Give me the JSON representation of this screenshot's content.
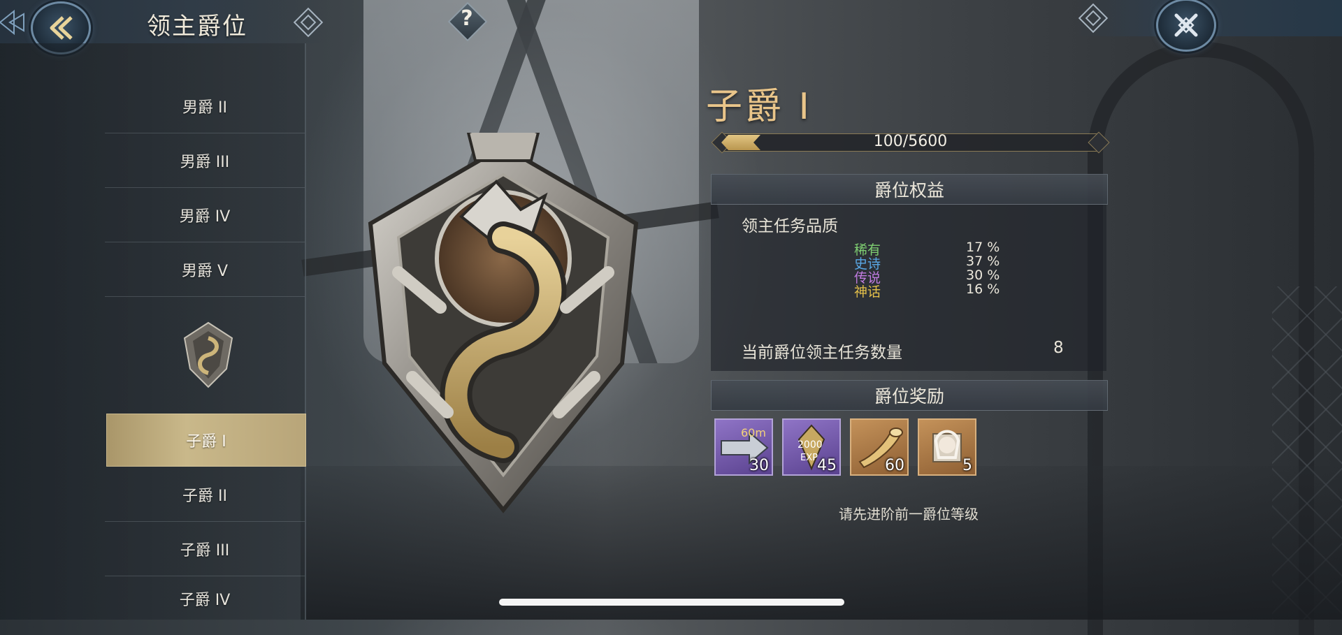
{
  "header": {
    "title": "领主爵位",
    "help_label": "?"
  },
  "sidebar": {
    "items": [
      {
        "label": "男爵 II",
        "active": false
      },
      {
        "label": "男爵 III",
        "active": false
      },
      {
        "label": "男爵 IV",
        "active": false
      },
      {
        "label": "男爵 V",
        "active": false
      },
      {
        "label": "子爵 I",
        "active": true
      },
      {
        "label": "子爵 II",
        "active": false
      },
      {
        "label": "子爵 III",
        "active": false
      },
      {
        "label": "子爵 IV",
        "active": false
      }
    ]
  },
  "detail": {
    "title": "子爵 I",
    "progress": {
      "text": "100/5600",
      "current": 100,
      "max": 5600
    },
    "benefits": {
      "header": "爵位权益",
      "quality_label": "领主任务品质",
      "qualities": [
        {
          "name": "稀有",
          "value": "17 %",
          "color": "#7fcf72"
        },
        {
          "name": "史诗",
          "value": "37 %",
          "color": "#5aa8e6"
        },
        {
          "name": "传说",
          "value": "30 %",
          "color": "#c07be0"
        },
        {
          "name": "神话",
          "value": "16 %",
          "color": "#e3bf4a"
        }
      ],
      "task_count_label": "当前爵位领主任务数量",
      "task_count_value": "8"
    },
    "rewards": {
      "header": "爵位奖励",
      "items": [
        {
          "icon": "speedup-60m-icon",
          "text": "60m",
          "count": "30",
          "rarity": "purple"
        },
        {
          "icon": "exp-2000-icon",
          "text": "2000",
          "count": "45",
          "rarity": "purple"
        },
        {
          "icon": "horn-icon",
          "count": "60",
          "rarity": "orange"
        },
        {
          "icon": "hero-portrait-icon",
          "count": "5",
          "rarity": "orange"
        }
      ],
      "note": "请先进阶前一爵位等级"
    }
  },
  "colors": {
    "gold": "#e9c58a",
    "active_tab": "#c9b88a"
  }
}
